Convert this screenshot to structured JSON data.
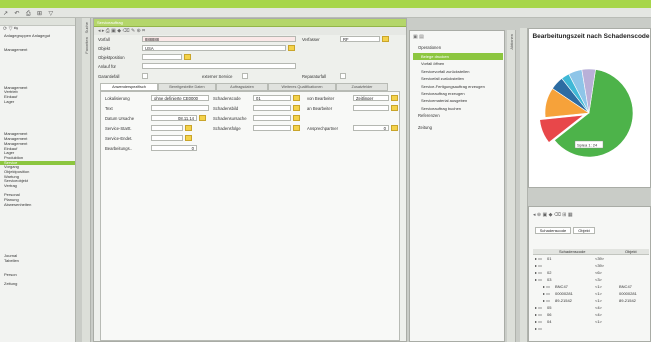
{
  "toolbar": {
    "icons": [
      "arrow-icon",
      "undo-icon",
      "print-icon",
      "grid-icon",
      "filter-icon"
    ],
    "glyphs": [
      "↗",
      "↶",
      "⎙",
      "⊞",
      "▽"
    ]
  },
  "left": {
    "tools": "⟳ ▽ ⇆",
    "items": [
      {
        "label": "Anlagegruppen Anlagegut",
        "sel": false
      },
      {
        "label": "",
        "sel": false
      },
      {
        "label": "",
        "sel": false
      },
      {
        "label": "Management",
        "sel": false
      },
      {
        "label": "",
        "sel": false
      },
      {
        "label": "",
        "sel": false
      },
      {
        "label": "",
        "sel": false
      },
      {
        "label": "",
        "sel": false
      },
      {
        "label": "",
        "sel": false
      },
      {
        "label": "",
        "sel": false
      },
      {
        "label": "",
        "sel": false
      },
      {
        "label": "Management",
        "sel": false
      },
      {
        "label": "Vertrieb",
        "sel": false
      },
      {
        "label": "Einkauf",
        "sel": false
      },
      {
        "label": "Lager",
        "sel": false
      },
      {
        "label": "",
        "sel": false
      },
      {
        "label": "",
        "sel": false
      },
      {
        "label": "",
        "sel": false
      },
      {
        "label": "",
        "sel": false
      },
      {
        "label": "",
        "sel": false
      },
      {
        "label": "",
        "sel": false
      },
      {
        "label": "Management",
        "sel": false
      },
      {
        "label": "Management",
        "sel": false
      },
      {
        "label": "Management",
        "sel": false
      },
      {
        "label": "Einkauf",
        "sel": false
      },
      {
        "label": "Lager",
        "sel": false
      },
      {
        "label": "Produktion",
        "sel": false
      },
      {
        "label": "Service",
        "sel": true
      },
      {
        "label": "Vorgang",
        "sel": false
      },
      {
        "label": "Objektposition",
        "sel": false
      },
      {
        "label": "Wartung",
        "sel": false
      },
      {
        "label": "Serviceobjekt",
        "sel": false
      },
      {
        "label": "Vertrag",
        "sel": false
      },
      {
        "label": "",
        "sel": false
      },
      {
        "label": "Personal",
        "sel": false
      },
      {
        "label": "Planung",
        "sel": false
      },
      {
        "label": "Abwesenheiten",
        "sel": false
      },
      {
        "label": "",
        "sel": false
      },
      {
        "label": "",
        "sel": false
      },
      {
        "label": "",
        "sel": false
      },
      {
        "label": "",
        "sel": false
      },
      {
        "label": "",
        "sel": false
      },
      {
        "label": "",
        "sel": false
      },
      {
        "label": "",
        "sel": false
      },
      {
        "label": "",
        "sel": false
      },
      {
        "label": "",
        "sel": false
      },
      {
        "label": "",
        "sel": false
      },
      {
        "label": "Journal",
        "sel": false
      },
      {
        "label": "Tabellen",
        "sel": false
      },
      {
        "label": "",
        "sel": false
      },
      {
        "label": "",
        "sel": false
      },
      {
        "label": "Person",
        "sel": false
      },
      {
        "label": "",
        "sel": false
      },
      {
        "label": "Zeitung",
        "sel": false
      }
    ]
  },
  "main": {
    "title": "Serviceauftrag",
    "tools": "◂ ▸ ⎙ ▣ ◆ ⌫ ✎ ⊕ ⌗",
    "fields": {
      "vorfall_label": "Vorfall",
      "vorfall_value": "888888",
      "verfasser_label": "Verfasser",
      "verfasser_value": "RF",
      "objekt_label": "Objekt",
      "objekt_value": "USA",
      "objektposition_label": "Objektposition",
      "anlauf_label": "Anlauf für",
      "garantiefall_label": "Garantiefall",
      "externer_label": "externer Service",
      "reparaturfall_label": "Reparaturfall"
    },
    "tabs": [
      "Anwenderspezifisch",
      "Bereitgestellte Daten",
      "Auftragsdaten",
      "Weiteres Qualifikationen",
      "Zusatzfelder"
    ],
    "detail": {
      "lokalisierung_label": "Lokalisierung",
      "lokalisierung_value": "ohne definierte CE0000",
      "schadenscode_label": "Schadenscode",
      "schadenscode_value": "01",
      "bearbeiter_label": "von Bearbeiter",
      "bearbeiter_value": "Zeitlinger",
      "text_label": "Text",
      "schadensbild_label": "Schadensbild",
      "an_bearbeiter_label": "an Bearbeiter",
      "datum_label": "Datum Ursache",
      "datum_value": "08.11.14",
      "schadensursache_label": "Schadensursache",
      "service_start_label": "Service-Startt.",
      "schadensfolge_label": "Schadensfolge",
      "ansprech_label": "Ansprechpartner",
      "ansprech_value": "0",
      "service_ende_label": "Service-Endet.",
      "bearbeitung_label": "Bearbeitungs..",
      "bearbeitung_value": "0"
    }
  },
  "actions": {
    "operationen": "Operationen",
    "items": [
      {
        "label": "Belege drucken",
        "sel": true
      },
      {
        "label": "Vorfall öffnen",
        "sel": false
      },
      {
        "label": "Servicevorfall zurückstellen",
        "sel": false
      },
      {
        "label": "Servicefall zurückstellen",
        "sel": false
      },
      {
        "label": "Service-Fertigungsauftrag erzeugen",
        "sel": false
      },
      {
        "label": "Serviceauftrag erzeugen",
        "sel": false
      },
      {
        "label": "Servicematerial ausgeben",
        "sel": false
      },
      {
        "label": "Serviceauftrag buchen",
        "sel": false
      }
    ],
    "referenzen": "Referenzen",
    "zeitung": "Zeitung"
  },
  "chart_data": {
    "type": "pie",
    "title": "Bearbeitungszeit nach Schadenscode",
    "series": [
      {
        "values": [
          62,
          9,
          11,
          5,
          3,
          5,
          5
        ]
      }
    ],
    "colors": [
      "#4db34a",
      "#e8474a",
      "#f6a23a",
      "#2d6ca2",
      "#3fb8d6",
      "#8ec5e8",
      "#b9b0d8"
    ],
    "callout": "Spiea 1: 24"
  },
  "table": {
    "tools": "◂ ⊕ ▣ ◆ ⌫ ⊞ ▦",
    "filters": [
      "Schadenscode",
      "Objekt"
    ],
    "headers": [
      "",
      "Schadenscode",
      "Objekt"
    ],
    "rows": [
      {
        "name": "01",
        "code": "<39>",
        "obj": "",
        "sel": false
      },
      {
        "name": "",
        "code": "<39>",
        "obj": "",
        "sel": false
      },
      {
        "name": "02",
        "code": "<6>",
        "obj": "",
        "sel": false
      },
      {
        "name": "03",
        "code": "<3>",
        "obj": "",
        "sel": false
      },
      {
        "name": "BNC47",
        "code": "<1>",
        "obj": "BNC47",
        "sel": false
      },
      {
        "name": "00000281",
        "code": "<1>",
        "obj": "00000281",
        "sel": false
      },
      {
        "name": "89-21542",
        "code": "<1>",
        "obj": "89-21542",
        "sel": false
      },
      {
        "name": "05",
        "code": "<4>",
        "obj": "",
        "sel": false
      },
      {
        "name": "06",
        "code": "<4>",
        "obj": "",
        "sel": false
      },
      {
        "name": "04",
        "code": "<1>",
        "obj": "",
        "sel": false
      },
      {
        "name": "",
        "code": "",
        "obj": "",
        "sel": false
      }
    ]
  }
}
